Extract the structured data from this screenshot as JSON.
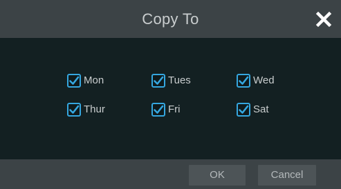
{
  "dialog": {
    "title": "Copy To",
    "close_icon": "close-icon"
  },
  "days": [
    {
      "label": "Mon",
      "checked": true
    },
    {
      "label": "Tues",
      "checked": true
    },
    {
      "label": "Wed",
      "checked": true
    },
    {
      "label": "Thur",
      "checked": true
    },
    {
      "label": "Fri",
      "checked": true
    },
    {
      "label": "Sat",
      "checked": true
    }
  ],
  "footer": {
    "ok_label": "OK",
    "cancel_label": "Cancel"
  },
  "colors": {
    "accent": "#35a7e0",
    "titlebar": "#3c4346",
    "body": "#132022",
    "text": "#c9cdce"
  }
}
